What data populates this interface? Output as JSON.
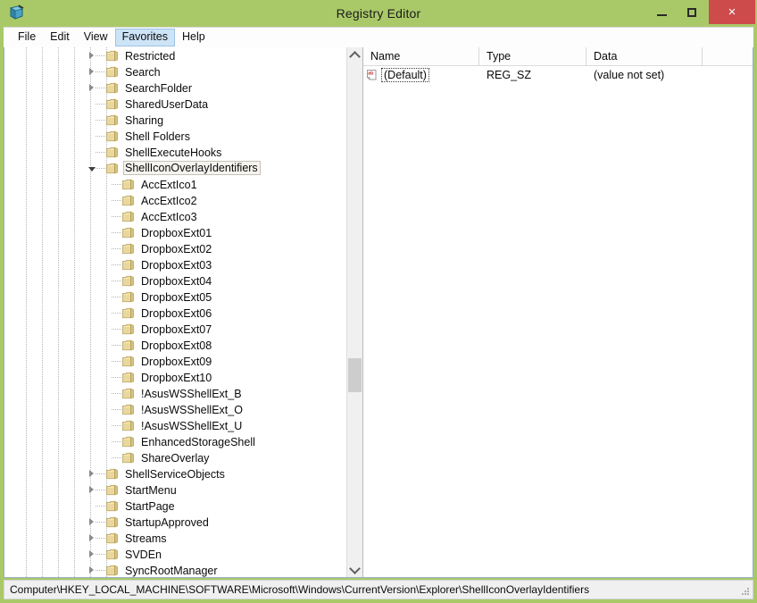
{
  "window": {
    "title": "Registry Editor",
    "app_icon": "registry-editor-icon",
    "controls": {
      "minimize": "minimize-icon",
      "maximize": "maximize-icon",
      "close": "×"
    },
    "titlebar_color": "#a9c968",
    "close_button_color": "#cd4b4b"
  },
  "menu": {
    "items": [
      {
        "label": "File",
        "active": false
      },
      {
        "label": "Edit",
        "active": false
      },
      {
        "label": "View",
        "active": false
      },
      {
        "label": "Favorites",
        "active": true
      },
      {
        "label": "Help",
        "active": false
      }
    ]
  },
  "tree": {
    "selected": "ShellIconOverlayIdentifiers",
    "nodes": [
      {
        "label": "Restricted",
        "depth": 6,
        "expander": "collapsed",
        "selected": false
      },
      {
        "label": "Search",
        "depth": 6,
        "expander": "collapsed",
        "selected": false
      },
      {
        "label": "SearchFolder",
        "depth": 6,
        "expander": "collapsed",
        "selected": false
      },
      {
        "label": "SharedUserData",
        "depth": 6,
        "expander": "none",
        "selected": false
      },
      {
        "label": "Sharing",
        "depth": 6,
        "expander": "none",
        "selected": false
      },
      {
        "label": "Shell Folders",
        "depth": 6,
        "expander": "none",
        "selected": false
      },
      {
        "label": "ShellExecuteHooks",
        "depth": 6,
        "expander": "none",
        "selected": false
      },
      {
        "label": "ShellIconOverlayIdentifiers",
        "depth": 6,
        "expander": "expanded",
        "selected": true
      },
      {
        "label": "AccExtIco1",
        "depth": 7,
        "expander": "none",
        "selected": false
      },
      {
        "label": "AccExtIco2",
        "depth": 7,
        "expander": "none",
        "selected": false
      },
      {
        "label": "AccExtIco3",
        "depth": 7,
        "expander": "none",
        "selected": false
      },
      {
        "label": "DropboxExt01",
        "depth": 7,
        "expander": "none",
        "selected": false
      },
      {
        "label": "DropboxExt02",
        "depth": 7,
        "expander": "none",
        "selected": false
      },
      {
        "label": "DropboxExt03",
        "depth": 7,
        "expander": "none",
        "selected": false
      },
      {
        "label": "DropboxExt04",
        "depth": 7,
        "expander": "none",
        "selected": false
      },
      {
        "label": "DropboxExt05",
        "depth": 7,
        "expander": "none",
        "selected": false
      },
      {
        "label": "DropboxExt06",
        "depth": 7,
        "expander": "none",
        "selected": false
      },
      {
        "label": "DropboxExt07",
        "depth": 7,
        "expander": "none",
        "selected": false
      },
      {
        "label": "DropboxExt08",
        "depth": 7,
        "expander": "none",
        "selected": false
      },
      {
        "label": "DropboxExt09",
        "depth": 7,
        "expander": "none",
        "selected": false
      },
      {
        "label": "DropboxExt10",
        "depth": 7,
        "expander": "none",
        "selected": false
      },
      {
        "label": "!AsusWSShellExt_B",
        "depth": 7,
        "expander": "none",
        "selected": false
      },
      {
        "label": "!AsusWSShellExt_O",
        "depth": 7,
        "expander": "none",
        "selected": false
      },
      {
        "label": "!AsusWSShellExt_U",
        "depth": 7,
        "expander": "none",
        "selected": false
      },
      {
        "label": "EnhancedStorageShell",
        "depth": 7,
        "expander": "none",
        "selected": false
      },
      {
        "label": "ShareOverlay",
        "depth": 7,
        "expander": "none",
        "selected": false
      },
      {
        "label": "ShellServiceObjects",
        "depth": 6,
        "expander": "collapsed",
        "selected": false
      },
      {
        "label": "StartMenu",
        "depth": 6,
        "expander": "collapsed",
        "selected": false
      },
      {
        "label": "StartPage",
        "depth": 6,
        "expander": "none",
        "selected": false
      },
      {
        "label": "StartupApproved",
        "depth": 6,
        "expander": "collapsed",
        "selected": false
      },
      {
        "label": "Streams",
        "depth": 6,
        "expander": "collapsed",
        "selected": false
      },
      {
        "label": "SVDEn",
        "depth": 6,
        "expander": "collapsed",
        "selected": false
      },
      {
        "label": "SyncRootManager",
        "depth": 6,
        "expander": "collapsed",
        "selected": false
      }
    ],
    "scrollbar": {
      "up_arrow": "chevron-up-icon",
      "down_arrow": "chevron-down-icon"
    }
  },
  "values": {
    "columns": [
      "Name",
      "Type",
      "Data"
    ],
    "rows": [
      {
        "icon": "string-value-icon",
        "name": "(Default)",
        "type": "REG_SZ",
        "data": "(value not set)",
        "focused": true
      }
    ]
  },
  "status": {
    "path": "Computer\\HKEY_LOCAL_MACHINE\\SOFTWARE\\Microsoft\\Windows\\CurrentVersion\\Explorer\\ShellIconOverlayIdentifiers",
    "grip": "resize-grip-icon"
  }
}
